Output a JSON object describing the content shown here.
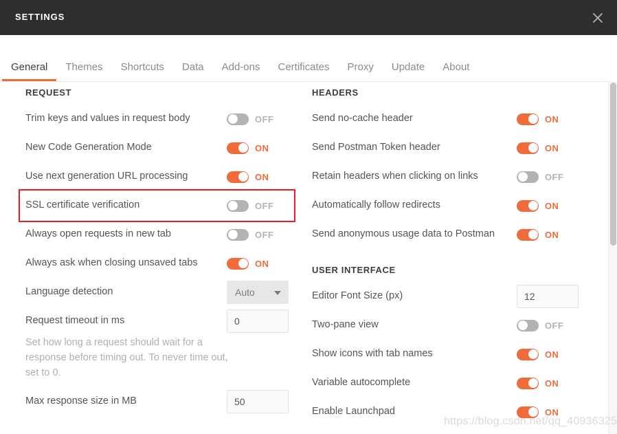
{
  "window": {
    "title": "SETTINGS",
    "close_icon": "close-icon"
  },
  "tabs": [
    {
      "label": "General",
      "active": true
    },
    {
      "label": "Themes",
      "active": false
    },
    {
      "label": "Shortcuts",
      "active": false
    },
    {
      "label": "Data",
      "active": false
    },
    {
      "label": "Add-ons",
      "active": false
    },
    {
      "label": "Certificates",
      "active": false
    },
    {
      "label": "Proxy",
      "active": false
    },
    {
      "label": "Update",
      "active": false
    },
    {
      "label": "About",
      "active": false
    }
  ],
  "left_column": {
    "section_title": "REQUEST",
    "rows": [
      {
        "label": "Trim keys and values in request body",
        "control": "toggle",
        "state": "OFF"
      },
      {
        "label": "New Code Generation Mode",
        "control": "toggle",
        "state": "ON"
      },
      {
        "label": "Use next generation URL processing",
        "control": "toggle",
        "state": "ON"
      },
      {
        "label": "SSL certificate verification",
        "control": "toggle",
        "state": "OFF",
        "highlighted": true
      },
      {
        "label": "Always open requests in new tab",
        "control": "toggle",
        "state": "OFF"
      },
      {
        "label": "Always ask when closing unsaved tabs",
        "control": "toggle",
        "state": "ON"
      },
      {
        "label": "Language detection",
        "control": "select",
        "value": "Auto"
      },
      {
        "label": "Request timeout in ms",
        "control": "input",
        "value": "0",
        "help": "Set how long a request should wait for a response before timing out. To never time out, set to 0."
      },
      {
        "label": "Max response size in MB",
        "control": "input",
        "value": "50"
      }
    ]
  },
  "right_column": {
    "headers_section": {
      "section_title": "HEADERS",
      "rows": [
        {
          "label": "Send no-cache header",
          "control": "toggle",
          "state": "ON"
        },
        {
          "label": "Send Postman Token header",
          "control": "toggle",
          "state": "ON"
        },
        {
          "label": "Retain headers when clicking on links",
          "control": "toggle",
          "state": "OFF"
        },
        {
          "label": "Automatically follow redirects",
          "control": "toggle",
          "state": "ON"
        },
        {
          "label": "Send anonymous usage data to Postman",
          "control": "toggle",
          "state": "ON"
        }
      ]
    },
    "ui_section": {
      "section_title": "USER INTERFACE",
      "rows": [
        {
          "label": "Editor Font Size (px)",
          "control": "input",
          "value": "12"
        },
        {
          "label": "Two-pane view",
          "control": "toggle",
          "state": "OFF"
        },
        {
          "label": "Show icons with tab names",
          "control": "toggle",
          "state": "ON"
        },
        {
          "label": "Variable autocomplete",
          "control": "toggle",
          "state": "ON"
        },
        {
          "label": "Enable Launchpad",
          "control": "toggle",
          "state": "ON"
        }
      ]
    }
  },
  "watermark": "https://blog.csdn.net/qq_40936325",
  "colors": {
    "accent_orange": "#ef6c3a",
    "titlebar_bg": "#2e2e2e",
    "toggle_off": "#b3b3b3",
    "annotation_red": "#ec1c24"
  }
}
